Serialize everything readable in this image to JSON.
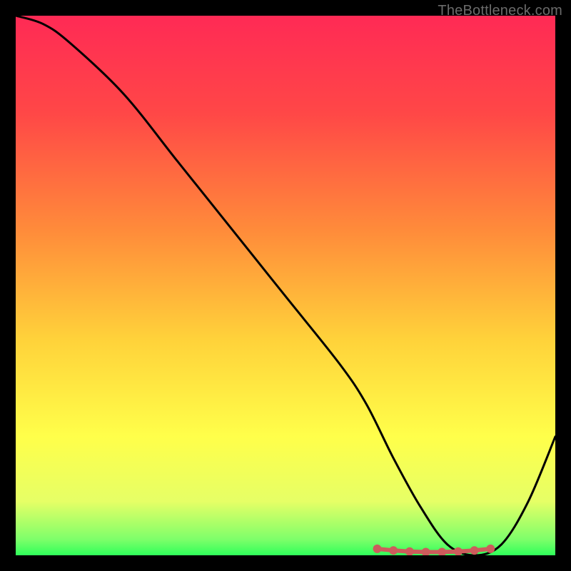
{
  "watermark": "TheBottleneck.com",
  "chart_data": {
    "type": "line",
    "title": "",
    "xlabel": "",
    "ylabel": "",
    "xlim": [
      0,
      100
    ],
    "ylim": [
      0,
      100
    ],
    "grid": false,
    "series": [
      {
        "name": "bottleneck-curve",
        "x": [
          0,
          5,
          10,
          20,
          30,
          40,
          50,
          60,
          65,
          70,
          75,
          80,
          85,
          90,
          95,
          100
        ],
        "y": [
          100,
          98.5,
          95,
          85.5,
          73,
          60.5,
          48,
          35.5,
          28,
          18,
          9,
          2,
          0,
          2,
          10,
          22
        ],
        "color": "#000000"
      },
      {
        "name": "highlight-region",
        "x": [
          67,
          70,
          73,
          76,
          79,
          82,
          85,
          88
        ],
        "y": [
          1.2,
          0.9,
          0.7,
          0.6,
          0.6,
          0.7,
          0.9,
          1.2
        ],
        "color": "#cd5c5c"
      }
    ],
    "gradient_stops": [
      {
        "offset": 0,
        "color": "#ff2a55"
      },
      {
        "offset": 18,
        "color": "#ff4747"
      },
      {
        "offset": 40,
        "color": "#ff8c3a"
      },
      {
        "offset": 60,
        "color": "#ffd23a"
      },
      {
        "offset": 78,
        "color": "#ffff4a"
      },
      {
        "offset": 90,
        "color": "#e6ff66"
      },
      {
        "offset": 97,
        "color": "#7fff6a"
      },
      {
        "offset": 100,
        "color": "#2fff5a"
      }
    ]
  }
}
